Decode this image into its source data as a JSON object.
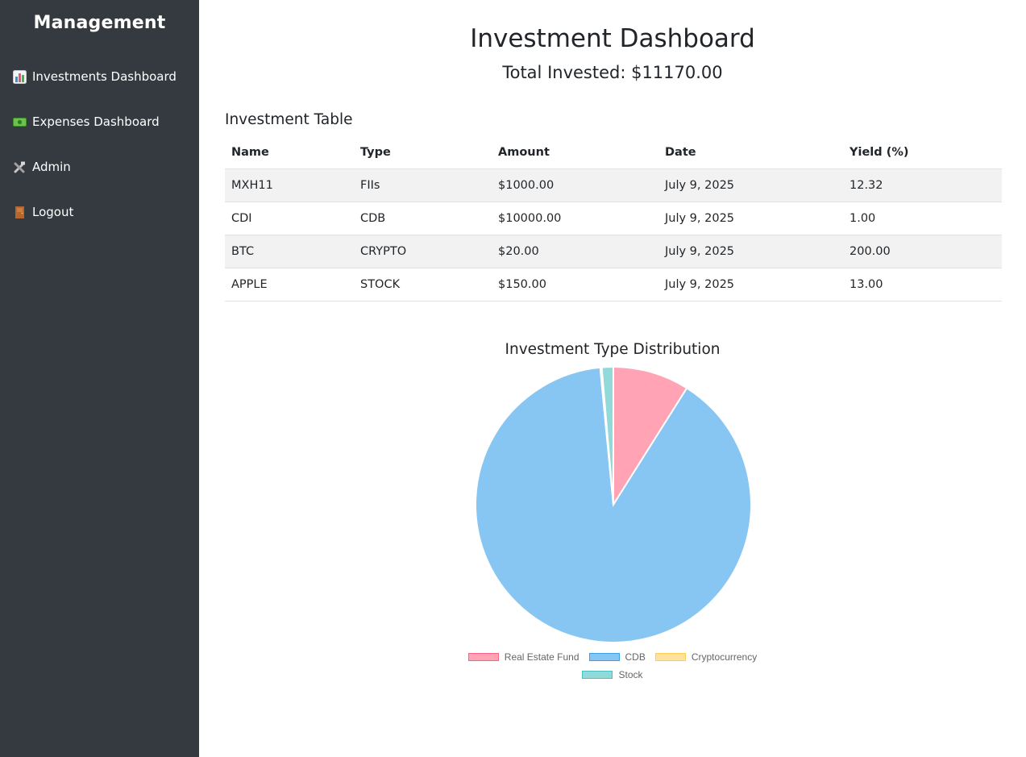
{
  "sidebar": {
    "brand": "Management",
    "items": [
      {
        "label": "Investments Dashboard",
        "icon": "bar-chart-icon"
      },
      {
        "label": "Expenses Dashboard",
        "icon": "money-icon"
      },
      {
        "label": "Admin",
        "icon": "tools-icon"
      },
      {
        "label": "Logout",
        "icon": "door-icon"
      }
    ]
  },
  "main": {
    "title": "Investment Dashboard",
    "total_invested": "Total Invested: $11170.00",
    "table_title": "Investment Table",
    "table": {
      "headers": [
        "Name",
        "Type",
        "Amount",
        "Date",
        "Yield (%)"
      ],
      "rows": [
        [
          "MXH11",
          "FIIs",
          "$1000.00",
          "July 9, 2025",
          "12.32"
        ],
        [
          "CDI",
          "CDB",
          "$10000.00",
          "July 9, 2025",
          "1.00"
        ],
        [
          "BTC",
          "CRYPTO",
          "$20.00",
          "July 9, 2025",
          "200.00"
        ],
        [
          "APPLE",
          "STOCK",
          "$150.00",
          "July 9, 2025",
          "13.00"
        ]
      ]
    }
  },
  "chart_data": {
    "type": "pie",
    "title": "Investment Type Distribution",
    "categories": [
      "Real Estate Fund",
      "CDB",
      "Cryptocurrency",
      "Stock"
    ],
    "values": [
      1000,
      10000,
      20,
      150
    ],
    "colors": [
      "#ffa3b5",
      "#87c6f2",
      "#ffe29e",
      "#92d9d9"
    ],
    "border_colors": [
      "#ff6384",
      "#36a2eb",
      "#ffcd56",
      "#4bc0c0"
    ],
    "legend_position": "bottom"
  }
}
